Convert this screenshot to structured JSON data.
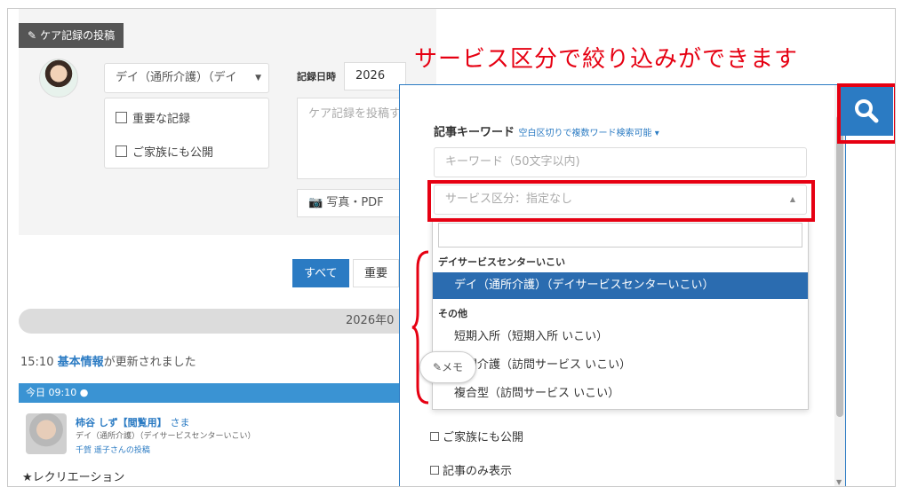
{
  "background": {
    "post_tab_label": "ケア記録の投稿",
    "service_select": "デイ（通所介護）（デイ",
    "checkbox_important": "重要な記録",
    "checkbox_family": "ご家族にも公開",
    "record_datetime_label": "記録日時",
    "record_year": "2026",
    "record_placeholder": "ケア記録を投稿す",
    "photo_button": "写真・PDF",
    "filter_all": "すべて",
    "filter_important": "重要",
    "date_header": "2026年0",
    "update_time": "15:10",
    "update_link": "基本情報",
    "update_text": "が更新されました",
    "today_label": "今日 09:10",
    "post_name": "柿谷 しず【閲覧用】",
    "post_honorific": "さま",
    "post_service": "デイ（通所介護）（デイサービスセンターいこい）",
    "post_author": "千賀 遥子さんの投稿",
    "post_body": "★レクリエーション"
  },
  "search_panel": {
    "keyword_label": "記事キーワード",
    "keyword_hint": "空白区切りで複数ワード検索可能",
    "keyword_placeholder": "キーワード（50文字以内)",
    "service_placeholder": "サービス区分：指定なし",
    "groups": [
      {
        "label": "デイサービスセンターいこい",
        "options": [
          "デイ（通所介護）（デイサービスセンターいこい）"
        ]
      },
      {
        "label": "その他",
        "options": [
          "短期入所（短期入所 いこい）",
          "訪問介護（訪問サービス いこい）",
          "複合型（訪問サービス いこい）"
        ]
      }
    ],
    "selected_option": "デイ（通所介護）（デイサービスセンターいこい）",
    "family_checkbox": "ご家族にも公開",
    "only_articles_checkbox": "記事のみ表示",
    "memo_button": "メモ"
  },
  "annotation": {
    "callout": "サービス区分で絞り込みができます",
    "color": "#e60012"
  },
  "colors": {
    "accent": "#2b7bc3",
    "selected": "#2b6cb0"
  }
}
